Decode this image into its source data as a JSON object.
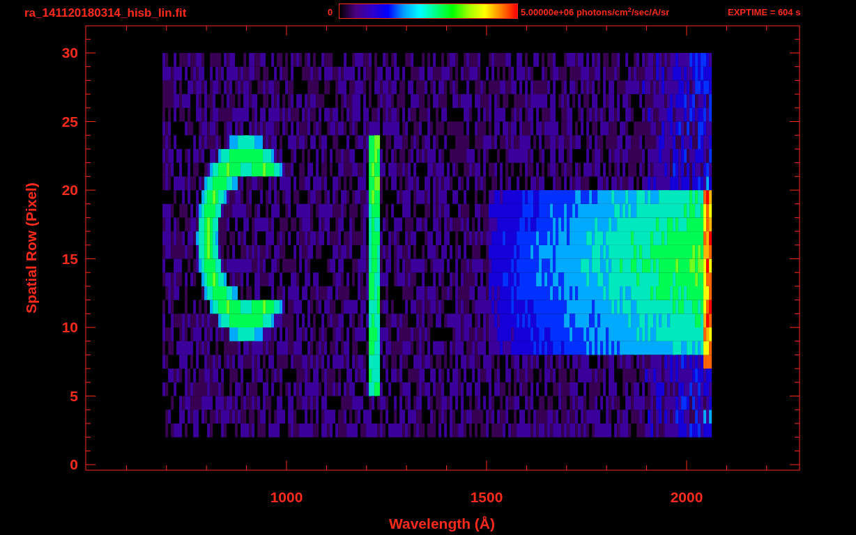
{
  "header": {
    "filename": "ra_141120180314_hisb_lin.fit",
    "colorbar": {
      "min_label": "0",
      "max_label": "5.00000e+06 photons/cm$^{2}$/sec/A/sr"
    },
    "exposure": "EXPTIME = 604 s"
  },
  "plot": {
    "xlabel": "Wavelength (Å)",
    "ylabel": "Spatial Row (Pixel)",
    "xticks": [
      "1000",
      "1500",
      "2000"
    ],
    "yticks": [
      "30",
      "25",
      "20",
      "15",
      "10",
      "5",
      "0"
    ]
  }
}
